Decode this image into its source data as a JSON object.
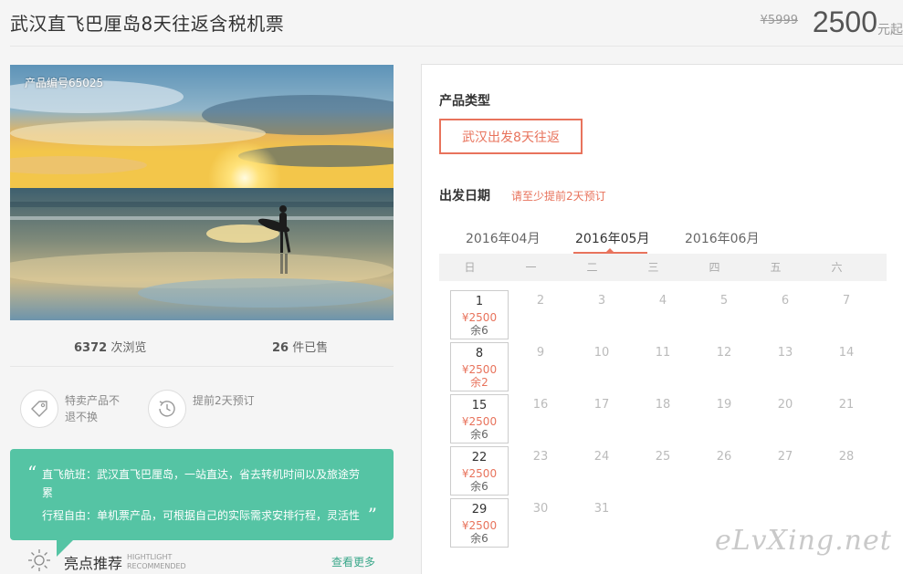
{
  "product": {
    "title": "武汉直飞巴厘岛8天往返含税机票",
    "old_price": "¥5999",
    "price": "2500",
    "price_unit": "元起",
    "code": "产品编号65025"
  },
  "stats": {
    "views_num": "6372",
    "views_label": " 次浏览",
    "sold_num": "26",
    "sold_label": " 件已售"
  },
  "features": [
    {
      "icon": "tag-icon",
      "text": "特卖产品不退不换"
    },
    {
      "icon": "clock-icon",
      "text": "提前2天预订"
    }
  ],
  "promo": {
    "open_quote": "“",
    "close_quote": "”",
    "line1": "直飞航班：武汉直飞巴厘岛，一站直达，省去转机时间以及旅途劳累",
    "line2": "行程自由：单机票产品，可根据自己的实际需求安排行程，灵活性"
  },
  "highlight": {
    "title": "亮点推荐",
    "sub_en_1": "HIGHTLIGHT",
    "sub_en_2": "RECOMMENDED",
    "more": "查看更多"
  },
  "booking": {
    "type_label": "产品类型",
    "type_option": "武汉出发8天往返",
    "date_label": "出发日期",
    "date_note": "请至少提前2天预订",
    "months": [
      "2016年04月",
      "2016年05月",
      "2016年06月"
    ],
    "active_month": "2016年05月",
    "weekdays": [
      "日",
      "一",
      "二",
      "三",
      "四",
      "五",
      "六"
    ],
    "weeks": [
      [
        {
          "d": "1",
          "p": "¥2500",
          "s": "余6"
        },
        {
          "d": "2"
        },
        {
          "d": "3"
        },
        {
          "d": "4"
        },
        {
          "d": "5"
        },
        {
          "d": "6"
        },
        {
          "d": "7"
        }
      ],
      [
        {
          "d": "8",
          "p": "¥2500",
          "s": "余2",
          "low": true
        },
        {
          "d": "9"
        },
        {
          "d": "10"
        },
        {
          "d": "11"
        },
        {
          "d": "12"
        },
        {
          "d": "13"
        },
        {
          "d": "14"
        }
      ],
      [
        {
          "d": "15",
          "p": "¥2500",
          "s": "余6"
        },
        {
          "d": "16"
        },
        {
          "d": "17"
        },
        {
          "d": "18"
        },
        {
          "d": "19"
        },
        {
          "d": "20"
        },
        {
          "d": "21"
        }
      ],
      [
        {
          "d": "22",
          "p": "¥2500",
          "s": "余6"
        },
        {
          "d": "23"
        },
        {
          "d": "24"
        },
        {
          "d": "25"
        },
        {
          "d": "26"
        },
        {
          "d": "27"
        },
        {
          "d": "28"
        }
      ],
      [
        {
          "d": "29",
          "p": "¥2500",
          "s": "余6"
        },
        {
          "d": "30"
        },
        {
          "d": "31"
        }
      ]
    ]
  },
  "watermark": "eLvXing.net",
  "colors": {
    "accent": "#e8735c",
    "green": "#55c4a4",
    "link": "#3aa78a"
  }
}
